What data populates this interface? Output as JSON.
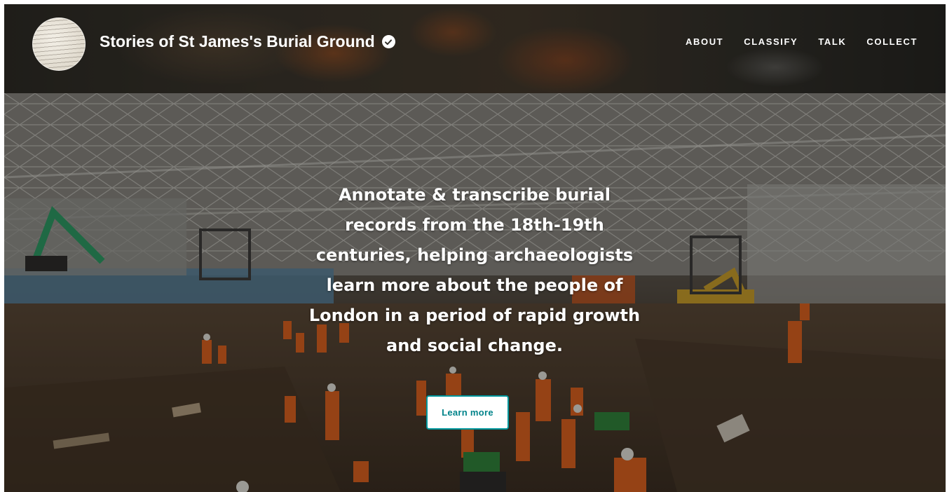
{
  "header": {
    "title": "Stories of St James's Burial Ground",
    "avatar_icon": "manuscript-avatar-icon",
    "verified_icon": "verified-check-icon"
  },
  "nav": {
    "items": [
      {
        "label": "ABOUT"
      },
      {
        "label": "CLASSIFY"
      },
      {
        "label": "TALK"
      },
      {
        "label": "COLLECT"
      }
    ]
  },
  "hero": {
    "lines": [
      "Annotate & transcribe burial",
      "records from the 18th-19th",
      "centuries, helping archaeologists",
      "learn more about the people of",
      "London in a period of rapid growth",
      "and social change."
    ],
    "button_label": "Learn more"
  },
  "colors": {
    "accent": "#00979d",
    "button_text": "#00838a",
    "hi_vis_orange": "#e8641e"
  }
}
